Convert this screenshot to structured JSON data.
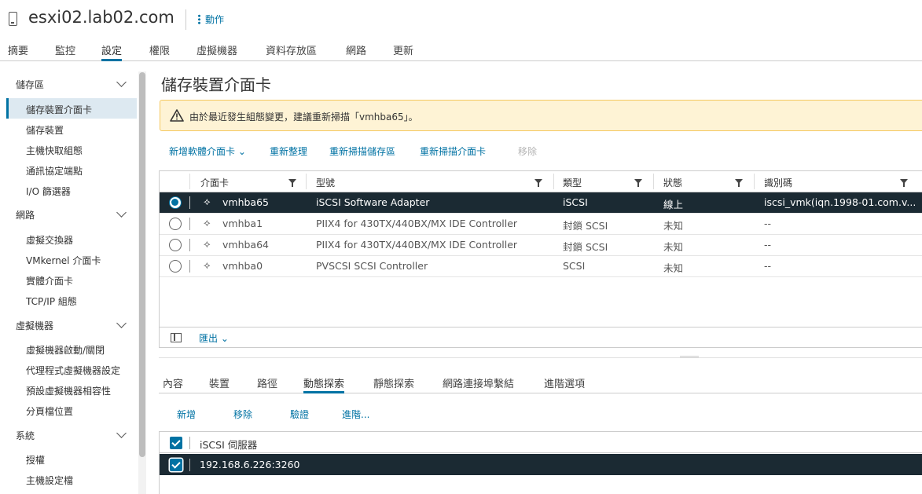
{
  "host": {
    "title": "esxi02.lab02.com",
    "actions_label": "動作"
  },
  "main_tabs": [
    "摘要",
    "監控",
    "設定",
    "權限",
    "虛擬機器",
    "資料存放區",
    "網路",
    "更新"
  ],
  "main_tab_active": "設定",
  "sidebar": {
    "sections": [
      {
        "label": "儲存區",
        "items": [
          "儲存裝置介面卡",
          "儲存裝置",
          "主機快取組態",
          "通訊協定端點",
          "I/O 篩選器"
        ]
      },
      {
        "label": "網路",
        "items": [
          "虛擬交換器",
          "VMkernel 介面卡",
          "實體介面卡",
          "TCP/IP 組態"
        ]
      },
      {
        "label": "虛擬機器",
        "items": [
          "虛擬機器啟動/關閉",
          "代理程式虛擬機器設定",
          "預設虛擬機器相容性",
          "分頁檔位置"
        ]
      },
      {
        "label": "系統",
        "items": [
          "授權",
          "主機設定檔"
        ]
      }
    ],
    "active_item": "儲存裝置介面卡"
  },
  "page": {
    "title": "儲存裝置介面卡",
    "alert": "由於最近發生組態變更，建議重新掃描「vmhba65」。"
  },
  "toolbar": {
    "add_software": "新增軟體介面卡",
    "refresh": "重新整理",
    "rescan_storage": "重新掃描儲存區",
    "rescan_adapter": "重新掃描介面卡",
    "remove": "移除"
  },
  "adapter_grid": {
    "columns": [
      "介面卡",
      "型號",
      "類型",
      "狀態",
      "識別碼"
    ],
    "rows": [
      {
        "adapter": "vmhba65",
        "model": "iSCSI Software Adapter",
        "type": "iSCSI",
        "status": "線上",
        "id": "iscsi_vmk(iqn.1998-01.com.v...",
        "selected": true
      },
      {
        "adapter": "vmhba1",
        "model": "PIIX4 for 430TX/440BX/MX IDE Controller",
        "type": "封鎖 SCSI",
        "status": "未知",
        "id": "--",
        "selected": false
      },
      {
        "adapter": "vmhba64",
        "model": "PIIX4 for 430TX/440BX/MX IDE Controller",
        "type": "封鎖 SCSI",
        "status": "未知",
        "id": "--",
        "selected": false
      },
      {
        "adapter": "vmhba0",
        "model": "PVSCSI SCSI Controller",
        "type": "SCSI",
        "status": "未知",
        "id": "--",
        "selected": false
      }
    ],
    "export_label": "匯出"
  },
  "sub_tabs": [
    "內容",
    "裝置",
    "路徑",
    "動態探索",
    "靜態探索",
    "網路連接埠繫結",
    "進階選項"
  ],
  "sub_tab_active": "動態探索",
  "sub_toolbar": {
    "add": "新增",
    "remove": "移除",
    "verify": "驗證",
    "advanced": "進階..."
  },
  "target_grid": {
    "header": "iSCSI 伺服器",
    "rows": [
      "192.168.6.226:3260"
    ]
  },
  "colors": {
    "accent": "#0072a3",
    "selected_row": "#1b2a33",
    "alert_bg": "#fef3d5"
  }
}
